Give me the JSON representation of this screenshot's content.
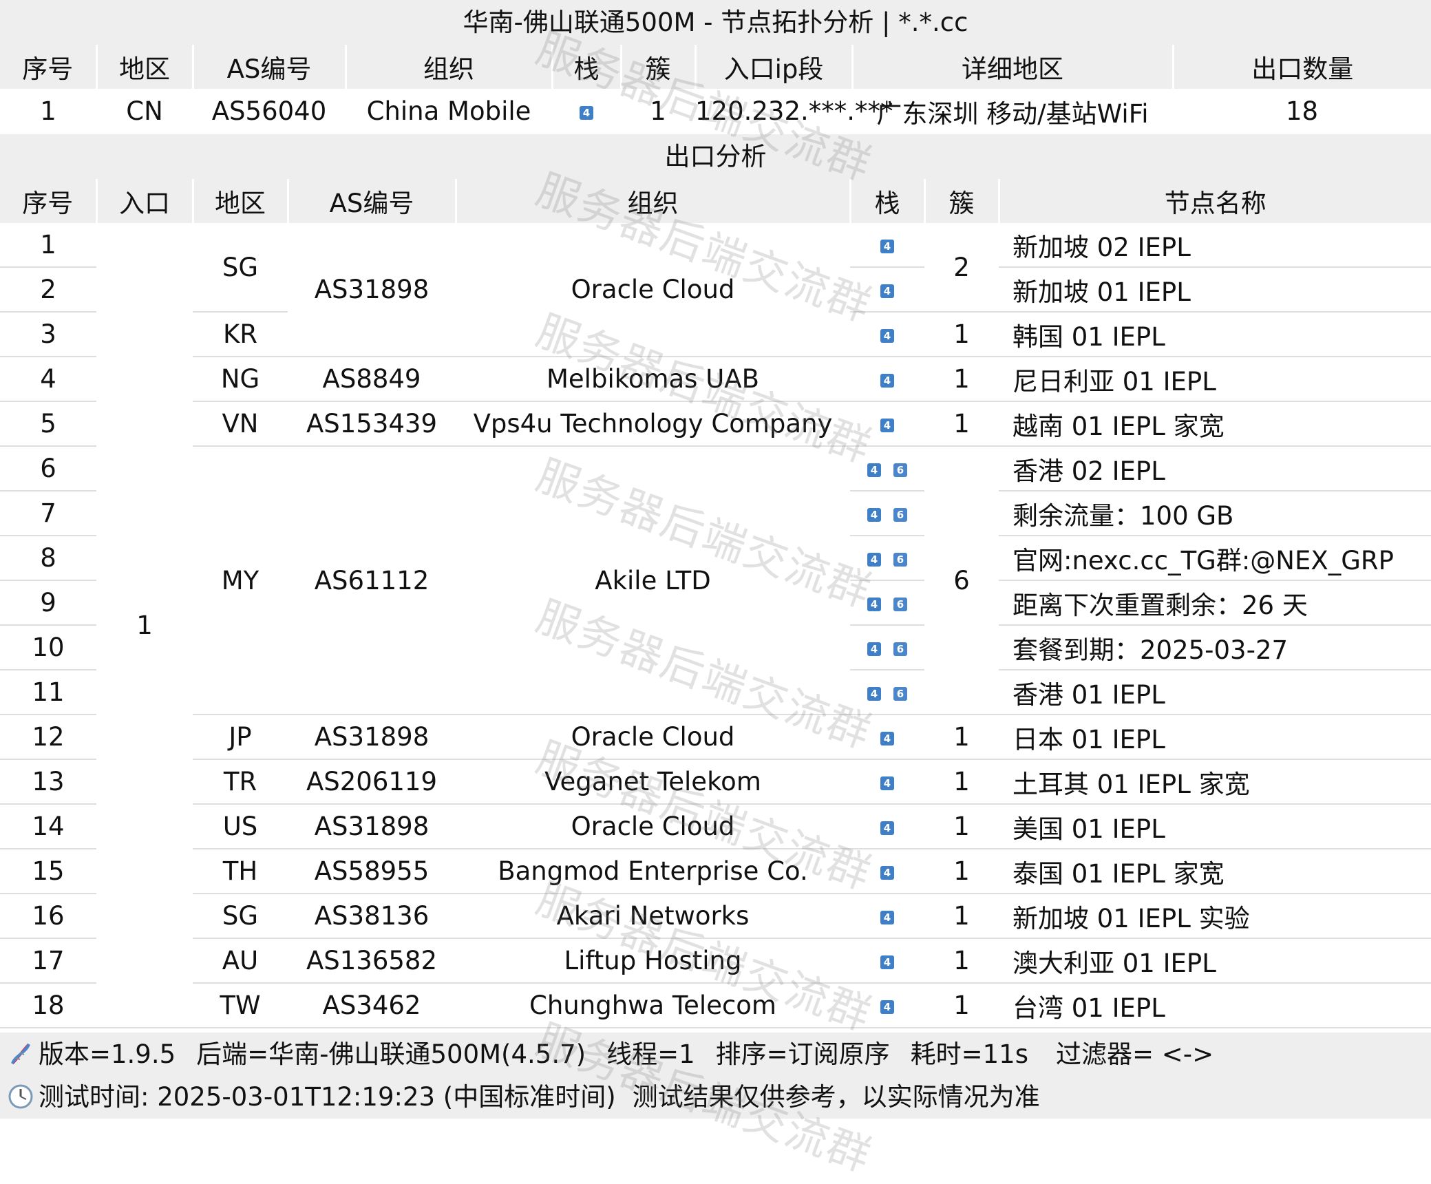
{
  "title": "华南-佛山联通500M - 节点拓扑分析 | *.*.cc",
  "entry_headers": [
    "序号",
    "地区",
    "AS编号",
    "组织",
    "栈",
    "簇",
    "入口ip段",
    "详细地区",
    "出口数量"
  ],
  "entry_row": {
    "index": "1",
    "region": "CN",
    "asn": "AS56040",
    "org": "China Mobile",
    "stack": "4",
    "cluster": "1",
    "ip": "120.232.***.***",
    "detail": "广东深圳 移动/基站WiFi",
    "exit_count": "18"
  },
  "section_title": "出口分析",
  "exit_headers": [
    "序号",
    "入口",
    "地区",
    "AS编号",
    "组织",
    "栈",
    "簇",
    "节点名称"
  ],
  "entry_merged": "1",
  "rows": [
    {
      "index": "1",
      "region": "SG",
      "asn": "AS31898",
      "org": "Oracle Cloud",
      "stack": [
        "4"
      ],
      "cluster": "2",
      "name": "新加坡 02 IEPL"
    },
    {
      "index": "2",
      "region": "SG",
      "asn": "AS31898",
      "org": "Oracle Cloud",
      "stack": [
        "4"
      ],
      "cluster": "2",
      "name": "新加坡 01 IEPL"
    },
    {
      "index": "3",
      "region": "KR",
      "asn": "AS31898",
      "org": "Oracle Cloud",
      "stack": [
        "4"
      ],
      "cluster": "1",
      "name": "韩国 01 IEPL"
    },
    {
      "index": "4",
      "region": "NG",
      "asn": "AS8849",
      "org": "Melbikomas UAB",
      "stack": [
        "4"
      ],
      "cluster": "1",
      "name": "尼日利亚 01 IEPL"
    },
    {
      "index": "5",
      "region": "VN",
      "asn": "AS153439",
      "org": "Vps4u Technology Company",
      "stack": [
        "4"
      ],
      "cluster": "1",
      "name": "越南 01 IEPL 家宽"
    },
    {
      "index": "6",
      "region": "MY",
      "asn": "AS61112",
      "org": "Akile LTD",
      "stack": [
        "4",
        "6"
      ],
      "cluster": "6",
      "name": "香港 02 IEPL"
    },
    {
      "index": "7",
      "region": "MY",
      "asn": "AS61112",
      "org": "Akile LTD",
      "stack": [
        "4",
        "6"
      ],
      "cluster": "6",
      "name": "剩余流量：100 GB"
    },
    {
      "index": "8",
      "region": "MY",
      "asn": "AS61112",
      "org": "Akile LTD",
      "stack": [
        "4",
        "6"
      ],
      "cluster": "6",
      "name": "官网:nexc.cc_TG群:@NEX_GRP"
    },
    {
      "index": "9",
      "region": "MY",
      "asn": "AS61112",
      "org": "Akile LTD",
      "stack": [
        "4",
        "6"
      ],
      "cluster": "6",
      "name": "距离下次重置剩余：26 天"
    },
    {
      "index": "10",
      "region": "MY",
      "asn": "AS61112",
      "org": "Akile LTD",
      "stack": [
        "4",
        "6"
      ],
      "cluster": "6",
      "name": "套餐到期：2025-03-27"
    },
    {
      "index": "11",
      "region": "MY",
      "asn": "AS61112",
      "org": "Akile LTD",
      "stack": [
        "4",
        "6"
      ],
      "cluster": "6",
      "name": "香港 01 IEPL"
    },
    {
      "index": "12",
      "region": "JP",
      "asn": "AS31898",
      "org": "Oracle Cloud",
      "stack": [
        "4"
      ],
      "cluster": "1",
      "name": "日本 01 IEPL"
    },
    {
      "index": "13",
      "region": "TR",
      "asn": "AS206119",
      "org": "Veganet Telekom",
      "stack": [
        "4"
      ],
      "cluster": "1",
      "name": "土耳其 01 IEPL 家宽"
    },
    {
      "index": "14",
      "region": "US",
      "asn": "AS31898",
      "org": "Oracle Cloud",
      "stack": [
        "4"
      ],
      "cluster": "1",
      "name": "美国 01 IEPL"
    },
    {
      "index": "15",
      "region": "TH",
      "asn": "AS58955",
      "org": "Bangmod Enterprise Co.",
      "stack": [
        "4"
      ],
      "cluster": "1",
      "name": "泰国 01 IEPL 家宽"
    },
    {
      "index": "16",
      "region": "SG",
      "asn": "AS38136",
      "org": "Akari Networks",
      "stack": [
        "4"
      ],
      "cluster": "1",
      "name": "新加坡 01 IEPL 实验"
    },
    {
      "index": "17",
      "region": "AU",
      "asn": "AS136582",
      "org": "Liftup Hosting",
      "stack": [
        "4"
      ],
      "cluster": "1",
      "name": "澳大利亚 01 IEPL"
    },
    {
      "index": "18",
      "region": "TW",
      "asn": "AS3462",
      "org": "Chunghwa Telecom",
      "stack": [
        "4"
      ],
      "cluster": "1",
      "name": "台湾 01 IEPL"
    }
  ],
  "footer": {
    "version": "版本=1.9.5",
    "backend": "后端=华南-佛山联通500M(4.5.7)",
    "threads": "线程=1",
    "sort": "排序=订阅原序",
    "elapsed": "耗时=11s",
    "filter": "过滤器= <->",
    "test_time": "测试时间: 2025-03-01T12:19:23 (中国标准时间)",
    "disclaimer": "测试结果仅供参考，以实际情况为准"
  },
  "watermark": "服务器后端交流群",
  "colors": {
    "header_bg": "#eeeeee",
    "badge": "#3e7fc8",
    "watermark": "#787878"
  }
}
